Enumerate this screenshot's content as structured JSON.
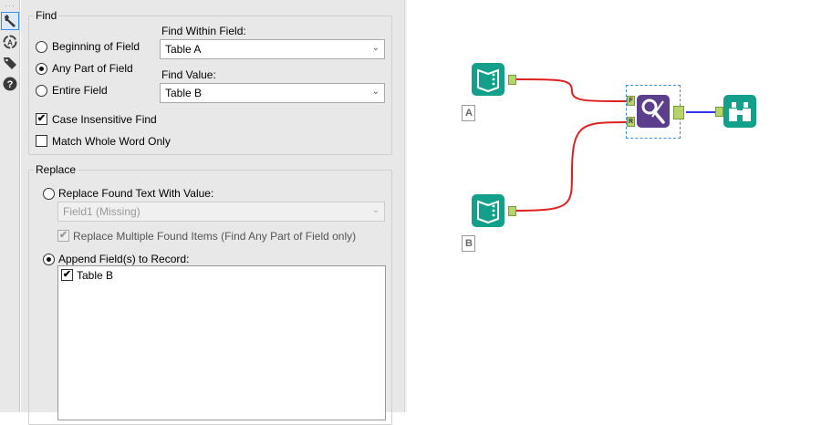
{
  "toolbar": {
    "icons": [
      "wrench-icon",
      "annotation-icon",
      "tag-icon",
      "help-icon"
    ]
  },
  "find": {
    "title": "Find",
    "options": [
      "Beginning of Field",
      "Any Part of Field",
      "Entire Field"
    ],
    "selected": "Any Part of Field",
    "within_label": "Find Within Field:",
    "within_value": "Table A",
    "value_label": "Find Value:",
    "value_value": "Table B",
    "case_insensitive": "Case Insensitive Find",
    "case_insensitive_checked": true,
    "whole_word": "Match Whole Word Only",
    "whole_word_checked": false
  },
  "replace": {
    "title": "Replace",
    "replace_text": "Replace Found Text With Value:",
    "replace_field": "Field1 (Missing)",
    "replace_multiple": "Replace Multiple Found Items (Find Any Part of Field only)",
    "append": "Append Field(s) to Record:",
    "append_fields": [
      {
        "name": "Table B",
        "checked": true
      }
    ]
  },
  "canvas": {
    "input_a_label": "A",
    "input_b_label": "B",
    "find_anchor": "F",
    "replace_anchor": "R",
    "colors": {
      "input": "#12a08a",
      "find_replace": "#5b3f8c",
      "connection": "#e02020",
      "output_connection": "#3333ee"
    }
  }
}
